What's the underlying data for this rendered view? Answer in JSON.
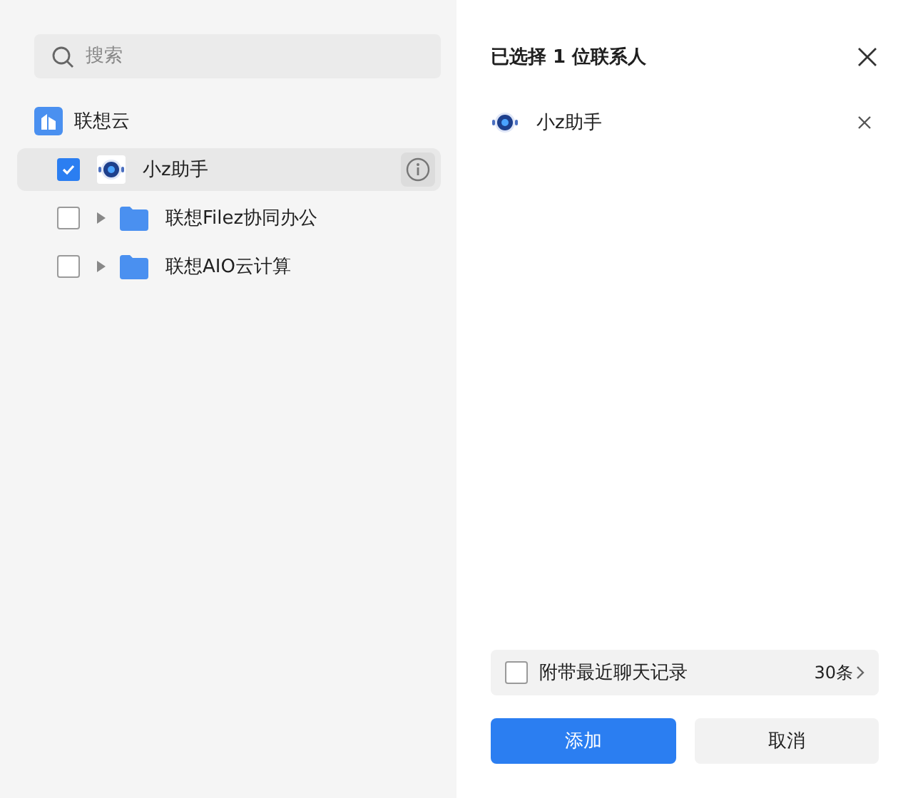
{
  "search": {
    "placeholder": "搜索"
  },
  "org": {
    "name": "联想云"
  },
  "tree": [
    {
      "kind": "contact",
      "label": "小z助手",
      "checked": true,
      "selected": true
    },
    {
      "kind": "group",
      "label": "联想Filez协同办公",
      "checked": false,
      "selected": false,
      "expanded": false
    },
    {
      "kind": "group",
      "label": "联想AIO云计算",
      "checked": false,
      "selected": false,
      "expanded": false
    }
  ],
  "panel": {
    "title": "已选择 1 位联系人"
  },
  "chosen": [
    {
      "name": "小z助手"
    }
  ],
  "attach": {
    "label": "附带最近聊天记录",
    "checked": false,
    "count": "30条"
  },
  "buttons": [
    {
      "label": "添加",
      "kind": "primary"
    },
    {
      "label": "取消",
      "kind": "secondary"
    }
  ]
}
